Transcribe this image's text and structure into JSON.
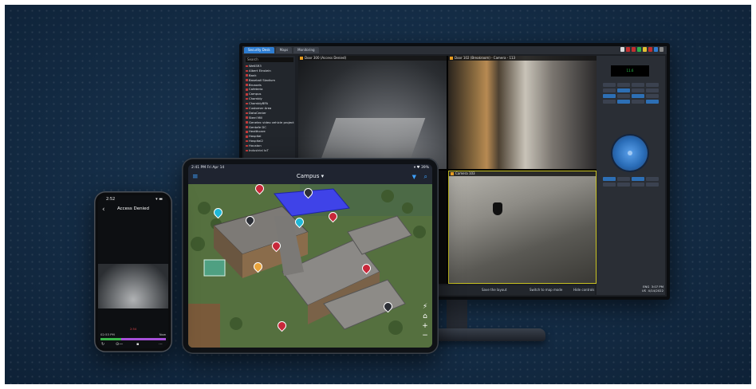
{
  "monitor": {
    "tabs": [
      "Security Desk",
      "Maps",
      "Monitoring"
    ],
    "panel": {
      "search_label": "Search",
      "entities": [
        "WeKSR3",
        "Albert Einstein",
        "Bank",
        "Baseball Stadium",
        "Brussels",
        "Cafeteria",
        "Campus",
        "Chambly",
        "ChamblyBPA",
        "Customer Area",
        "DataCenter",
        "Steel Mill",
        "Genetec video vehicle project",
        "Gentafe DC",
        "Healthcare",
        "Hospital",
        "Hospital2",
        "Houston",
        "Industrial IoT"
      ]
    },
    "tiles": [
      {
        "title": "Door 300 (Access Denied)"
      },
      {
        "title": "Door 102 (Breakroom) - Camera - 113"
      },
      {
        "title": ""
      },
      {
        "title": "Camera 103"
      }
    ],
    "ptz_readout": "11.6",
    "bottombar": {
      "status_left": "Save the layout",
      "status_mid": "Switch to map mode",
      "status_right": "Hide controls"
    },
    "clock": {
      "lang": "ENG",
      "lang2": "US",
      "time": "3:07 PM",
      "date": "4/14/2022"
    }
  },
  "tablet": {
    "status_time": "2:41 PM  Fri Apr 14",
    "status_battery": "▾ ♥ 39%",
    "title": "Campus ▾",
    "icons": {
      "menu": "menu-icon",
      "filter": "filter-icon",
      "search": "search-icon"
    },
    "controls": [
      "+",
      "−"
    ]
  },
  "phone": {
    "status_time": "2:52",
    "status_right": "▾ ▬",
    "title": "Access Denied",
    "time_left": "02:53 PM",
    "time_mid": "2:54",
    "time_right": "Now",
    "track_colors": {
      "recorded": "#39b54a",
      "motion": "#a64fd8"
    }
  },
  "colors": {
    "accent": "#2e7dd1",
    "ios_blue": "#3da1ff",
    "alarm_red": "#c8283a",
    "highlight_blue": "#3f43e8"
  }
}
